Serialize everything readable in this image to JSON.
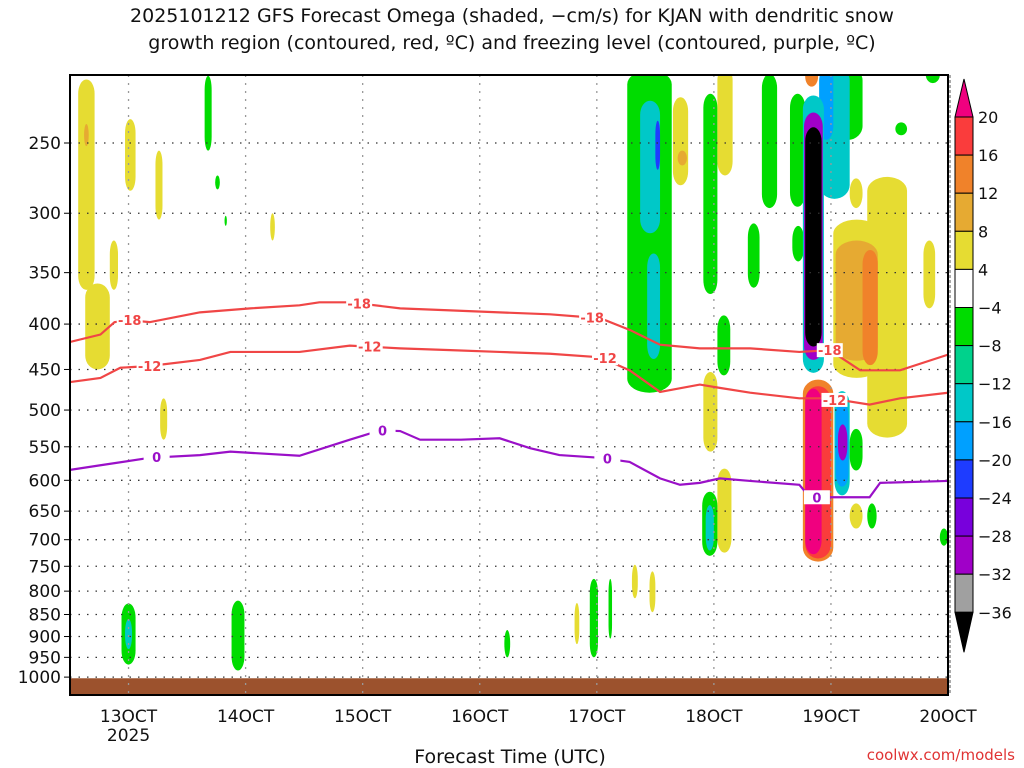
{
  "chart_data": {
    "type": "heatmap",
    "title_lines": [
      "2025101212 GFS Forecast Omega (shaded, −cm/s) for KJAN with dendritic snow",
      "growth region (contoured, red, ºC) and freezing level (contoured, purple, ºC)"
    ],
    "xlabel": "Forecast Time (UTC)",
    "credit": "coolwx.com/models",
    "x_range_days_oct": [
      12.5,
      20.0
    ],
    "y_range_hpa": [
      210,
      1050
    ],
    "y_scale": "log",
    "grid": true,
    "x_ticks": [
      {
        "day": 13,
        "label": "13OCT",
        "sub": "2025"
      },
      {
        "day": 14,
        "label": "14OCT"
      },
      {
        "day": 15,
        "label": "15OCT"
      },
      {
        "day": 16,
        "label": "16OCT"
      },
      {
        "day": 17,
        "label": "17OCT"
      },
      {
        "day": 18,
        "label": "18OCT"
      },
      {
        "day": 19,
        "label": "19OCT"
      },
      {
        "day": 20,
        "label": "20OCT"
      }
    ],
    "y_ticks": [
      250,
      300,
      350,
      400,
      450,
      500,
      550,
      600,
      650,
      700,
      750,
      800,
      850,
      900,
      950,
      1000
    ],
    "surface_pressure_hpa": 1003,
    "colorbar": {
      "labels": [
        "20",
        "16",
        "12",
        "8",
        "4",
        "−4",
        "−8",
        "−12",
        "−16",
        "−20",
        "−24",
        "−28",
        "−32",
        "−36"
      ],
      "over_color": "#f0007f",
      "under_color": "#000000",
      "colors": [
        "#fa3c3c",
        "#f0822a",
        "#e6aa32",
        "#e6dc32",
        "#ffffff",
        "#00dc00",
        "#00d28c",
        "#00c8c8",
        "#00a0ff",
        "#1e3cff",
        "#7800dc",
        "#a000c8",
        "#a0a0a0"
      ],
      "bounds": [
        20,
        16,
        12,
        8,
        4,
        -4,
        -8,
        -12,
        -16,
        -20,
        -24,
        -28,
        -32,
        -36
      ]
    },
    "shading": [
      {
        "d": [
          17.26,
          17.64
        ],
        "p": [
          207,
          478
        ],
        "v": -6
      },
      {
        "d": [
          17.37,
          17.54
        ],
        "p": [
          224,
          316
        ],
        "v": -14
      },
      {
        "d": [
          17.43,
          17.54
        ],
        "p": [
          333,
          438
        ],
        "v": -12
      },
      {
        "d": [
          17.5,
          17.54
        ],
        "p": [
          236,
          268
        ],
        "v": -20
      },
      {
        "d": [
          17.65,
          17.78
        ],
        "p": [
          222,
          279
        ],
        "v": 6
      },
      {
        "d": [
          17.69,
          17.77
        ],
        "p": [
          255,
          265
        ],
        "v": 10
      },
      {
        "d": [
          17.91,
          18.03
        ],
        "p": [
          220,
          370
        ],
        "v": -6
      },
      {
        "d": [
          18.03,
          18.16
        ],
        "p": [
          205,
          272
        ],
        "v": 6
      },
      {
        "d": [
          18.41,
          18.54
        ],
        "p": [
          209,
          296
        ],
        "v": -6
      },
      {
        "d": [
          18.29,
          18.39
        ],
        "p": [
          308,
          364
        ],
        "v": -6
      },
      {
        "d": [
          18.03,
          18.14
        ],
        "p": [
          391,
          457
        ],
        "v": -6
      },
      {
        "d": [
          18.65,
          18.78
        ],
        "p": [
          220,
          295
        ],
        "v": -6
      },
      {
        "d": [
          18.67,
          18.77
        ],
        "p": [
          310,
          340
        ],
        "v": -6
      },
      {
        "d": [
          19.02,
          19.27
        ],
        "p": [
          205,
          248
        ],
        "v": -6
      },
      {
        "d": [
          18.9,
          19.16
        ],
        "p": [
          205,
          289
        ],
        "v": -14
      },
      {
        "d": [
          18.9,
          19.02
        ],
        "p": [
          205,
          248
        ],
        "v": -18
      },
      {
        "d": [
          18.76,
          18.94
        ],
        "p": [
          221,
          454
        ],
        "v": -14
      },
      {
        "d": [
          18.77,
          18.93
        ],
        "p": [
          231,
          439
        ],
        "v": -30
      },
      {
        "d": [
          18.78,
          18.92
        ],
        "p": [
          240,
          424
        ],
        "v": -40
      },
      {
        "d": [
          18.78,
          18.89
        ],
        "p": [
          205,
          216
        ],
        "v": 14
      },
      {
        "d": [
          19.02,
          19.42
        ],
        "p": [
          305,
          460
        ],
        "v": 6
      },
      {
        "d": [
          19.31,
          19.65
        ],
        "p": [
          273,
          537
        ],
        "v": 6
      },
      {
        "d": [
          19.04,
          19.4
        ],
        "p": [
          322,
          440
        ],
        "v": 10
      },
      {
        "d": [
          19.27,
          19.4
        ],
        "p": [
          330,
          445
        ],
        "v": 14
      },
      {
        "d": [
          19.16,
          19.27
        ],
        "p": [
          274,
          296
        ],
        "v": 6
      },
      {
        "d": [
          19.79,
          19.89
        ],
        "p": [
          322,
          384
        ],
        "v": 6
      },
      {
        "d": [
          19.55,
          19.65
        ],
        "p": [
          237,
          245
        ],
        "v": -6
      },
      {
        "d": [
          19.81,
          19.93
        ],
        "p": [
          205,
          214
        ],
        "v": -6
      },
      {
        "d": [
          18.76,
          19.02
        ],
        "p": [
          462,
          741
        ],
        "v": 14
      },
      {
        "d": [
          18.78,
          19.0
        ],
        "p": [
          470,
          735
        ],
        "v": 18
      },
      {
        "d": [
          18.78,
          18.92
        ],
        "p": [
          473,
          727
        ],
        "v": 24
      },
      {
        "d": [
          19.03,
          19.16
        ],
        "p": [
          476,
          624
        ],
        "v": -12
      },
      {
        "d": [
          19.04,
          19.15
        ],
        "p": [
          490,
          610
        ],
        "v": -18
      },
      {
        "d": [
          19.06,
          19.14
        ],
        "p": [
          519,
          570
        ],
        "v": -30
      },
      {
        "d": [
          19.16,
          19.27
        ],
        "p": [
          525,
          585
        ],
        "v": -6
      },
      {
        "d": [
          17.91,
          18.03
        ],
        "p": [
          453,
          557
        ],
        "v": 6
      },
      {
        "d": [
          18.03,
          18.15
        ],
        "p": [
          582,
          724
        ],
        "v": 6
      },
      {
        "d": [
          17.9,
          18.03
        ],
        "p": [
          618,
          730
        ],
        "v": -6
      },
      {
        "d": [
          17.93,
          18.0
        ],
        "p": [
          640,
          720
        ],
        "v": -14
      },
      {
        "d": [
          19.16,
          19.27
        ],
        "p": [
          637,
          680
        ],
        "v": 6
      },
      {
        "d": [
          19.31,
          19.39
        ],
        "p": [
          637,
          680
        ],
        "v": -6
      },
      {
        "d": [
          19.93,
          20.0
        ],
        "p": [
          680,
          711
        ],
        "v": -6
      },
      {
        "d": [
          17.3,
          17.35
        ],
        "p": [
          747,
          815
        ],
        "v": 6
      },
      {
        "d": [
          17.45,
          17.5
        ],
        "p": [
          760,
          845
        ],
        "v": 6
      },
      {
        "d": [
          17.1,
          17.13
        ],
        "p": [
          775,
          905
        ],
        "v": -6
      },
      {
        "d": [
          16.81,
          16.85
        ],
        "p": [
          825,
          918
        ],
        "v": 6
      },
      {
        "d": [
          16.94,
          17.01
        ],
        "p": [
          775,
          950
        ],
        "v": -6
      },
      {
        "d": [
          16.21,
          16.26
        ],
        "p": [
          885,
          950
        ],
        "v": -6
      },
      {
        "d": [
          12.94,
          13.06
        ],
        "p": [
          826,
          968
        ],
        "v": -6
      },
      {
        "d": [
          12.97,
          13.03
        ],
        "p": [
          860,
          930
        ],
        "v": -12
      },
      {
        "d": [
          13.88,
          13.99
        ],
        "p": [
          820,
          983
        ],
        "v": -6
      },
      {
        "d": [
          12.57,
          12.71
        ],
        "p": [
          212,
          366
        ],
        "v": 6
      },
      {
        "d": [
          12.62,
          12.66
        ],
        "p": [
          238,
          252
        ],
        "v": 10
      },
      {
        "d": [
          12.97,
          13.06
        ],
        "p": [
          235,
          283
        ],
        "v": 6
      },
      {
        "d": [
          13.23,
          13.29
        ],
        "p": [
          255,
          305
        ],
        "v": 6
      },
      {
        "d": [
          12.84,
          12.91
        ],
        "p": [
          322,
          366
        ],
        "v": 6
      },
      {
        "d": [
          12.63,
          12.84
        ],
        "p": [
          360,
          450
        ],
        "v": 6
      },
      {
        "d": [
          13.65,
          13.71
        ],
        "p": [
          210,
          255
        ],
        "v": -6
      },
      {
        "d": [
          13.74,
          13.78
        ],
        "p": [
          272,
          282
        ],
        "v": -6
      },
      {
        "d": [
          13.82,
          13.84
        ],
        "p": [
          302,
          310
        ],
        "v": -6
      },
      {
        "d": [
          13.27,
          13.33
        ],
        "p": [
          485,
          540
        ],
        "v": 6
      },
      {
        "d": [
          14.21,
          14.25
        ],
        "p": [
          300,
          322
        ],
        "v": 6
      }
    ],
    "contours": [
      {
        "level": -18,
        "color": "#f04646",
        "points": [
          [
            12.5,
            419
          ],
          [
            12.76,
            411
          ],
          [
            12.88,
            398
          ],
          [
            13.01,
            396
          ],
          [
            13.18,
            398
          ],
          [
            13.61,
            388
          ],
          [
            14.04,
            384
          ],
          [
            14.46,
            381
          ],
          [
            14.63,
            378
          ],
          [
            14.89,
            378
          ],
          [
            15.32,
            384
          ],
          [
            15.75,
            386
          ],
          [
            16.17,
            388
          ],
          [
            16.6,
            390
          ],
          [
            17.03,
            394
          ],
          [
            17.28,
            406
          ],
          [
            17.54,
            422
          ],
          [
            17.88,
            426
          ],
          [
            18.31,
            426
          ],
          [
            18.73,
            430
          ],
          [
            18.99,
            428
          ],
          [
            19.25,
            451
          ],
          [
            19.59,
            451
          ],
          [
            20.0,
            433
          ]
        ],
        "labels": [
          {
            "text": "-18",
            "day": 13.01,
            "p": 396
          },
          {
            "text": "-18",
            "day": 14.97,
            "p": 379
          },
          {
            "text": "-18",
            "day": 16.96,
            "p": 393
          },
          {
            "text": "-18",
            "day": 18.99,
            "p": 428
          }
        ]
      },
      {
        "level": -12,
        "color": "#f04646",
        "points": [
          [
            12.5,
            465
          ],
          [
            12.76,
            460
          ],
          [
            12.93,
            448
          ],
          [
            13.18,
            446
          ],
          [
            13.61,
            439
          ],
          [
            13.87,
            430
          ],
          [
            14.46,
            430
          ],
          [
            14.89,
            423
          ],
          [
            15.32,
            426
          ],
          [
            15.75,
            428
          ],
          [
            16.17,
            430
          ],
          [
            16.6,
            432
          ],
          [
            17.03,
            436
          ],
          [
            17.28,
            451
          ],
          [
            17.54,
            477
          ],
          [
            17.88,
            468
          ],
          [
            18.05,
            472
          ],
          [
            18.31,
            478
          ],
          [
            18.73,
            485
          ],
          [
            18.99,
            485
          ],
          [
            19.33,
            493
          ],
          [
            19.59,
            485
          ],
          [
            20.0,
            478
          ]
        ],
        "labels": [
          {
            "text": "-12",
            "day": 13.18,
            "p": 446
          },
          {
            "text": "-12",
            "day": 15.06,
            "p": 424
          },
          {
            "text": "-12",
            "day": 17.07,
            "p": 437
          },
          {
            "text": "-12",
            "day": 19.03,
            "p": 487
          }
        ]
      },
      {
        "level": 0,
        "color": "#9a10c8",
        "points": [
          [
            12.5,
            584
          ],
          [
            12.76,
            577
          ],
          [
            13.18,
            566
          ],
          [
            13.61,
            562
          ],
          [
            13.87,
            557
          ],
          [
            14.46,
            563
          ],
          [
            14.89,
            540
          ],
          [
            15.15,
            527
          ],
          [
            15.32,
            528
          ],
          [
            15.49,
            540
          ],
          [
            15.84,
            540
          ],
          [
            16.17,
            538
          ],
          [
            16.43,
            552
          ],
          [
            16.68,
            562
          ],
          [
            17.03,
            566
          ],
          [
            17.28,
            572
          ],
          [
            17.54,
            597
          ],
          [
            17.71,
            607
          ],
          [
            17.88,
            604
          ],
          [
            18.05,
            597
          ],
          [
            18.31,
            601
          ],
          [
            18.73,
            607
          ],
          [
            18.82,
            627
          ],
          [
            18.99,
            627
          ],
          [
            19.33,
            627
          ],
          [
            19.42,
            604
          ],
          [
            20.0,
            601
          ]
        ],
        "labels": [
          {
            "text": "0",
            "day": 13.24,
            "p": 565
          },
          {
            "text": "0",
            "day": 15.17,
            "p": 527
          },
          {
            "text": "0",
            "day": 17.09,
            "p": 567
          },
          {
            "text": "0",
            "day": 18.88,
            "p": 627
          }
        ]
      }
    ]
  }
}
